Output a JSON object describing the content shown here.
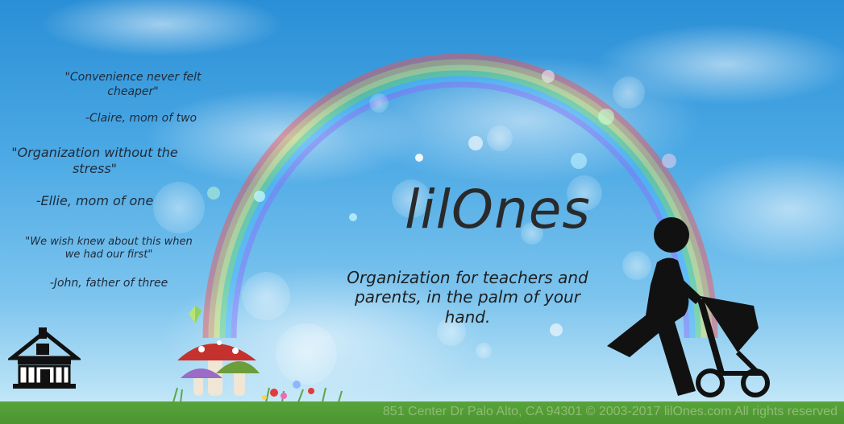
{
  "testimonials": [
    {
      "quote": "\"Convenience never felt cheaper\"",
      "author": "-Claire, mom of two"
    },
    {
      "quote": "\"Organization without  the stress\"",
      "author": "-Ellie, mom of one"
    },
    {
      "quote": "\"We wish knew about this when we had our first\"",
      "author": "-John, father of three"
    }
  ],
  "brand": {
    "logo_text": "lilOnes"
  },
  "hero": {
    "tagline": "Organization for teachers and parents, in the palm of your hand."
  },
  "footer": {
    "text": "851 Center Dr Palo Alto, CA 94301 © 2003-2017 lilOnes.com All rights reserved"
  },
  "icons": {
    "house": "house-icon",
    "walker": "parent-with-stroller-icon",
    "butterfly": "butterfly-icon"
  },
  "colors": {
    "sky_top": "#2a8fd6",
    "grass": "#58a43a",
    "text_dark": "#1e2b3a"
  }
}
